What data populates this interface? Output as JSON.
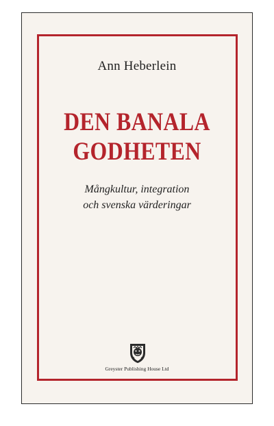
{
  "cover": {
    "author": "Ann Heberlein",
    "title_lines": [
      "DEN BANALA",
      "GODHETEN"
    ],
    "subtitle_lines": [
      "Mångkultur, integration",
      "och svenska värderingar"
    ],
    "publisher": "Greyster Publishing House Ltd",
    "publisher_logo": "lion-head-crest-icon"
  },
  "colors": {
    "accent_red": "#b4242c",
    "paper": "#f7f3ee",
    "text": "#1f1f1f"
  }
}
